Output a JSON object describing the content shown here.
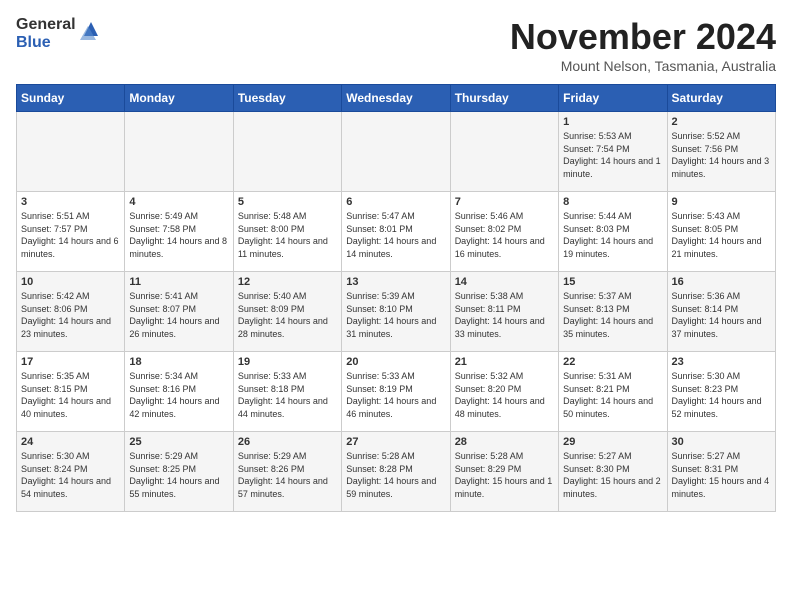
{
  "logo": {
    "general": "General",
    "blue": "Blue"
  },
  "header": {
    "month": "November 2024",
    "location": "Mount Nelson, Tasmania, Australia"
  },
  "weekdays": [
    "Sunday",
    "Monday",
    "Tuesday",
    "Wednesday",
    "Thursday",
    "Friday",
    "Saturday"
  ],
  "weeks": [
    [
      {
        "day": "",
        "info": ""
      },
      {
        "day": "",
        "info": ""
      },
      {
        "day": "",
        "info": ""
      },
      {
        "day": "",
        "info": ""
      },
      {
        "day": "",
        "info": ""
      },
      {
        "day": "1",
        "info": "Sunrise: 5:53 AM\nSunset: 7:54 PM\nDaylight: 14 hours and 1 minute."
      },
      {
        "day": "2",
        "info": "Sunrise: 5:52 AM\nSunset: 7:56 PM\nDaylight: 14 hours and 3 minutes."
      }
    ],
    [
      {
        "day": "3",
        "info": "Sunrise: 5:51 AM\nSunset: 7:57 PM\nDaylight: 14 hours and 6 minutes."
      },
      {
        "day": "4",
        "info": "Sunrise: 5:49 AM\nSunset: 7:58 PM\nDaylight: 14 hours and 8 minutes."
      },
      {
        "day": "5",
        "info": "Sunrise: 5:48 AM\nSunset: 8:00 PM\nDaylight: 14 hours and 11 minutes."
      },
      {
        "day": "6",
        "info": "Sunrise: 5:47 AM\nSunset: 8:01 PM\nDaylight: 14 hours and 14 minutes."
      },
      {
        "day": "7",
        "info": "Sunrise: 5:46 AM\nSunset: 8:02 PM\nDaylight: 14 hours and 16 minutes."
      },
      {
        "day": "8",
        "info": "Sunrise: 5:44 AM\nSunset: 8:03 PM\nDaylight: 14 hours and 19 minutes."
      },
      {
        "day": "9",
        "info": "Sunrise: 5:43 AM\nSunset: 8:05 PM\nDaylight: 14 hours and 21 minutes."
      }
    ],
    [
      {
        "day": "10",
        "info": "Sunrise: 5:42 AM\nSunset: 8:06 PM\nDaylight: 14 hours and 23 minutes."
      },
      {
        "day": "11",
        "info": "Sunrise: 5:41 AM\nSunset: 8:07 PM\nDaylight: 14 hours and 26 minutes."
      },
      {
        "day": "12",
        "info": "Sunrise: 5:40 AM\nSunset: 8:09 PM\nDaylight: 14 hours and 28 minutes."
      },
      {
        "day": "13",
        "info": "Sunrise: 5:39 AM\nSunset: 8:10 PM\nDaylight: 14 hours and 31 minutes."
      },
      {
        "day": "14",
        "info": "Sunrise: 5:38 AM\nSunset: 8:11 PM\nDaylight: 14 hours and 33 minutes."
      },
      {
        "day": "15",
        "info": "Sunrise: 5:37 AM\nSunset: 8:13 PM\nDaylight: 14 hours and 35 minutes."
      },
      {
        "day": "16",
        "info": "Sunrise: 5:36 AM\nSunset: 8:14 PM\nDaylight: 14 hours and 37 minutes."
      }
    ],
    [
      {
        "day": "17",
        "info": "Sunrise: 5:35 AM\nSunset: 8:15 PM\nDaylight: 14 hours and 40 minutes."
      },
      {
        "day": "18",
        "info": "Sunrise: 5:34 AM\nSunset: 8:16 PM\nDaylight: 14 hours and 42 minutes."
      },
      {
        "day": "19",
        "info": "Sunrise: 5:33 AM\nSunset: 8:18 PM\nDaylight: 14 hours and 44 minutes."
      },
      {
        "day": "20",
        "info": "Sunrise: 5:33 AM\nSunset: 8:19 PM\nDaylight: 14 hours and 46 minutes."
      },
      {
        "day": "21",
        "info": "Sunrise: 5:32 AM\nSunset: 8:20 PM\nDaylight: 14 hours and 48 minutes."
      },
      {
        "day": "22",
        "info": "Sunrise: 5:31 AM\nSunset: 8:21 PM\nDaylight: 14 hours and 50 minutes."
      },
      {
        "day": "23",
        "info": "Sunrise: 5:30 AM\nSunset: 8:23 PM\nDaylight: 14 hours and 52 minutes."
      }
    ],
    [
      {
        "day": "24",
        "info": "Sunrise: 5:30 AM\nSunset: 8:24 PM\nDaylight: 14 hours and 54 minutes."
      },
      {
        "day": "25",
        "info": "Sunrise: 5:29 AM\nSunset: 8:25 PM\nDaylight: 14 hours and 55 minutes."
      },
      {
        "day": "26",
        "info": "Sunrise: 5:29 AM\nSunset: 8:26 PM\nDaylight: 14 hours and 57 minutes."
      },
      {
        "day": "27",
        "info": "Sunrise: 5:28 AM\nSunset: 8:28 PM\nDaylight: 14 hours and 59 minutes."
      },
      {
        "day": "28",
        "info": "Sunrise: 5:28 AM\nSunset: 8:29 PM\nDaylight: 15 hours and 1 minute."
      },
      {
        "day": "29",
        "info": "Sunrise: 5:27 AM\nSunset: 8:30 PM\nDaylight: 15 hours and 2 minutes."
      },
      {
        "day": "30",
        "info": "Sunrise: 5:27 AM\nSunset: 8:31 PM\nDaylight: 15 hours and 4 minutes."
      }
    ]
  ]
}
